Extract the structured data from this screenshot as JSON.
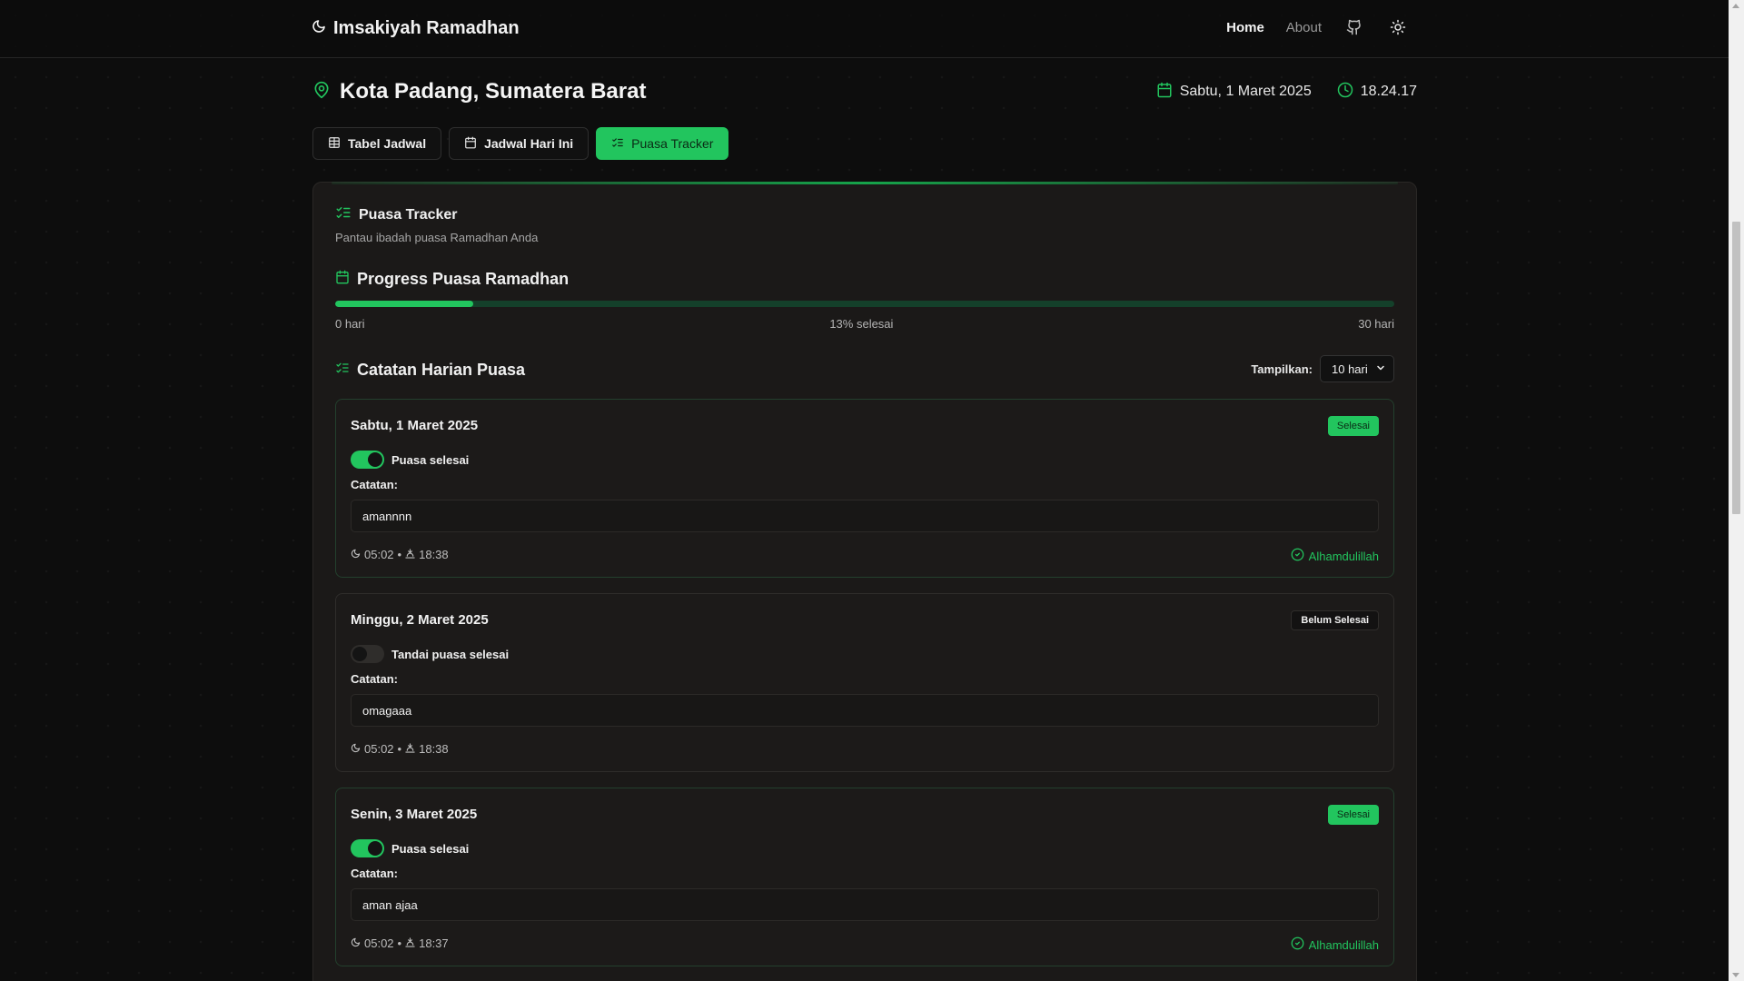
{
  "header": {
    "title": "Imsakiyah Ramadhan",
    "nav": {
      "home": "Home",
      "about": "About"
    },
    "icons": {
      "logo": "moon-icon",
      "github": "github-icon",
      "theme": "sun-icon"
    }
  },
  "location": {
    "title": "Kota Padang, Sumatera Barat",
    "date": "Sabtu, 1 Maret 2025",
    "time": "18.24.17"
  },
  "tabs": [
    {
      "label": "Tabel Jadwal",
      "icon": "table-icon",
      "active": false
    },
    {
      "label": "Jadwal Hari Ini",
      "icon": "calendar-icon",
      "active": false
    },
    {
      "label": "Puasa Tracker",
      "icon": "list-checks-icon",
      "active": true
    }
  ],
  "tracker": {
    "title": "Puasa Tracker",
    "subtitle": "Pantau ibadah puasa Ramadhan Anda",
    "progress": {
      "title": "Progress Puasa Ramadhan",
      "percent": 13,
      "label_start": "0 hari",
      "label_mid": "13% selesai",
      "label_end": "30 hari"
    },
    "log": {
      "title": "Catatan Harian Puasa",
      "show_label": "Tampilkan:",
      "show_value": "10 hari"
    },
    "notes_label": "Catatan:",
    "alhamdulillah": "Alhamdulillah",
    "entries": [
      {
        "date": "Sabtu, 1 Maret 2025",
        "status": "Selesai",
        "done": true,
        "toggle_label": "Puasa selesai",
        "note": "amannnn",
        "imsak": "05:02",
        "sep": "•",
        "maghrib": "18:38"
      },
      {
        "date": "Minggu, 2 Maret 2025",
        "status": "Belum Selesai",
        "done": false,
        "toggle_label": "Tandai puasa selesai",
        "note": "omagaaa",
        "imsak": "05:02",
        "sep": "•",
        "maghrib": "18:38"
      },
      {
        "date": "Senin, 3 Maret 2025",
        "status": "Selesai",
        "done": true,
        "toggle_label": "Puasa selesai",
        "note": "aman ajaa",
        "imsak": "05:02",
        "sep": "•",
        "maghrib": "18:37"
      }
    ]
  },
  "colors": {
    "accent": "#22c55e",
    "background": "#0d0d0d",
    "card": "#1b1918"
  }
}
